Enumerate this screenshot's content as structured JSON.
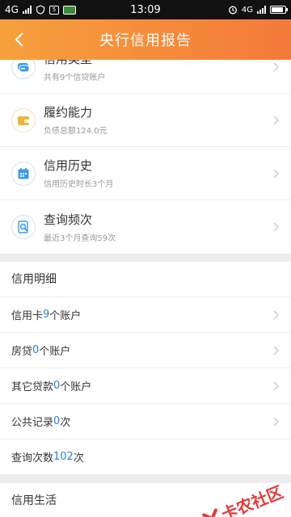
{
  "status_bar": {
    "network": "4G",
    "time": "13:09",
    "right_network": "4G"
  },
  "header": {
    "title": "央行信用报告"
  },
  "summary": [
    {
      "title": "信用类型",
      "sub": "共有9个信贷账户",
      "icon": "card-stack-icon",
      "icon_color": "#3a9be8"
    },
    {
      "title": "履约能力",
      "sub": "负债总额124.0元",
      "icon": "wallet-icon",
      "icon_color": "#f2b33d"
    },
    {
      "title": "信用历史",
      "sub": "信用历史时长3个月",
      "icon": "calendar-icon",
      "icon_color": "#3a9be8"
    },
    {
      "title": "查询频次",
      "sub": "最近3个月查询59次",
      "icon": "search-document-icon",
      "icon_color": "#3a9be8"
    }
  ],
  "details": {
    "title": "信用明细",
    "rows": [
      {
        "prefix": "信用卡",
        "num": "9",
        "suffix": "个账户"
      },
      {
        "prefix": "房贷",
        "num": "0",
        "suffix": "个账户"
      },
      {
        "prefix": "其它贷款",
        "num": "0",
        "suffix": "个账户"
      },
      {
        "prefix": "公共记录",
        "num": "0",
        "suffix": "次"
      },
      {
        "prefix": "查询次数",
        "num": "102",
        "suffix": "次"
      }
    ]
  },
  "life": {
    "title": "信用生活"
  },
  "watermark": {
    "text": "卡农社区"
  },
  "colors": {
    "header_start": "#f6a03c",
    "header_end": "#f47a3a",
    "number_blue": "#2f7fd8",
    "watermark_red": "#e53a3a"
  }
}
